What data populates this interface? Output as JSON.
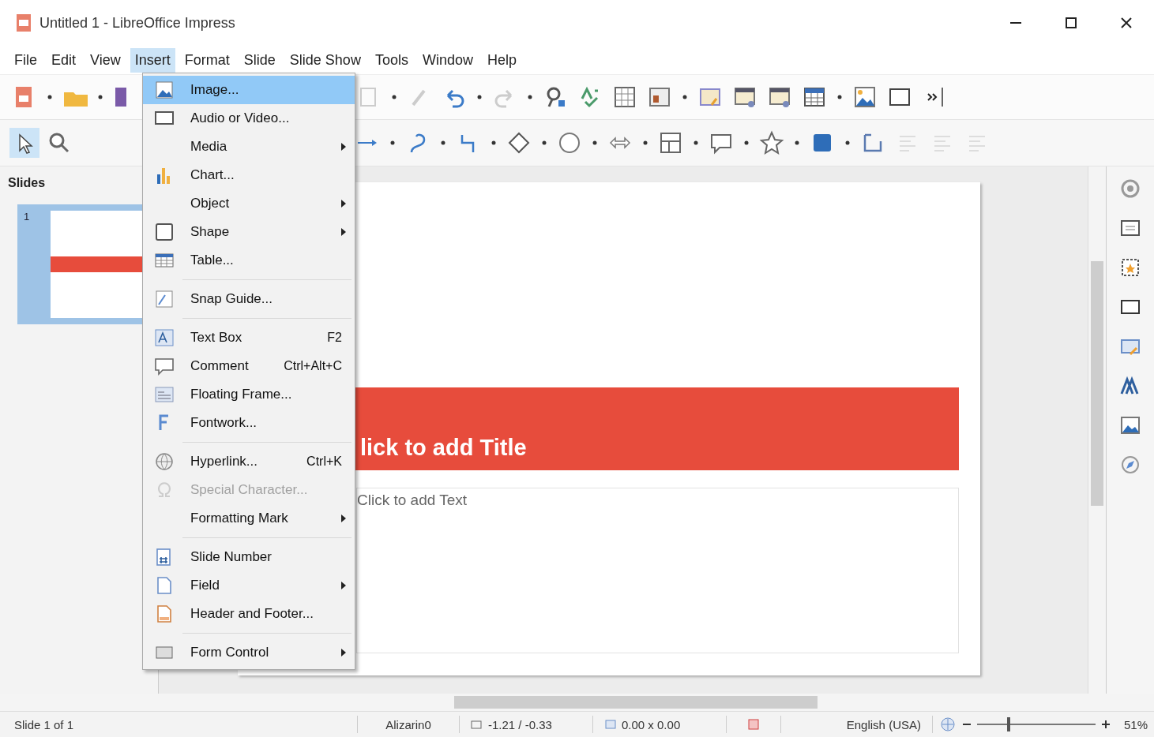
{
  "window": {
    "title": "Untitled 1 - LibreOffice Impress"
  },
  "menu_bar": [
    {
      "label": "File",
      "selected": false
    },
    {
      "label": "Edit",
      "selected": false
    },
    {
      "label": "View",
      "selected": false
    },
    {
      "label": "Insert",
      "selected": true
    },
    {
      "label": "Format",
      "selected": false
    },
    {
      "label": "Slide",
      "selected": false
    },
    {
      "label": "Slide Show",
      "selected": false
    },
    {
      "label": "Tools",
      "selected": false
    },
    {
      "label": "Window",
      "selected": false
    },
    {
      "label": "Help",
      "selected": false
    }
  ],
  "insert_menu": [
    {
      "kind": "item",
      "label": "Image...",
      "selected": true,
      "disabled": false,
      "submenu": false
    },
    {
      "kind": "item",
      "label": "Audio or Video...",
      "selected": false,
      "disabled": false,
      "submenu": false
    },
    {
      "kind": "item",
      "label": "Media",
      "selected": false,
      "disabled": false,
      "submenu": true
    },
    {
      "kind": "item",
      "label": "Chart...",
      "selected": false,
      "disabled": false,
      "submenu": false
    },
    {
      "kind": "item",
      "label": "Object",
      "selected": false,
      "disabled": false,
      "submenu": true
    },
    {
      "kind": "item",
      "label": "Shape",
      "selected": false,
      "disabled": false,
      "submenu": true
    },
    {
      "kind": "item",
      "label": "Table...",
      "selected": false,
      "disabled": false,
      "submenu": false
    },
    {
      "kind": "separator"
    },
    {
      "kind": "item",
      "label": "Snap Guide...",
      "selected": false,
      "disabled": false,
      "submenu": false
    },
    {
      "kind": "separator"
    },
    {
      "kind": "item",
      "label": "Text Box",
      "shortcut": "F2",
      "selected": false,
      "disabled": false,
      "submenu": false
    },
    {
      "kind": "item",
      "label": "Comment",
      "shortcut": "Ctrl+Alt+C",
      "selected": false,
      "disabled": false,
      "submenu": false
    },
    {
      "kind": "item",
      "label": "Floating Frame...",
      "selected": false,
      "disabled": false,
      "submenu": false
    },
    {
      "kind": "item",
      "label": "Fontwork...",
      "selected": false,
      "disabled": false,
      "submenu": false
    },
    {
      "kind": "separator"
    },
    {
      "kind": "item",
      "label": "Hyperlink...",
      "shortcut": "Ctrl+K",
      "selected": false,
      "disabled": false,
      "submenu": false
    },
    {
      "kind": "item",
      "label": "Special Character...",
      "selected": false,
      "disabled": true,
      "submenu": false
    },
    {
      "kind": "item",
      "label": "Formatting Mark",
      "selected": false,
      "disabled": false,
      "submenu": true
    },
    {
      "kind": "separator"
    },
    {
      "kind": "item",
      "label": "Slide Number",
      "selected": false,
      "disabled": false,
      "submenu": false
    },
    {
      "kind": "item",
      "label": "Field",
      "selected": false,
      "disabled": false,
      "submenu": true
    },
    {
      "kind": "item",
      "label": "Header and Footer...",
      "selected": false,
      "disabled": false,
      "submenu": false
    },
    {
      "kind": "separator"
    },
    {
      "kind": "item",
      "label": "Form Control",
      "selected": false,
      "disabled": false,
      "submenu": true
    }
  ],
  "slides_pane": {
    "title": "Slides",
    "slides": [
      {
        "number": "1",
        "selected": true
      }
    ]
  },
  "slide": {
    "title_placeholder": "lick to add Title",
    "text_placeholder": "Click to add Text"
  },
  "status_bar": {
    "slide": "Slide 1 of 1",
    "master": "Alizarin0",
    "position": "-1.21 / -0.33",
    "size": "0.00 x 0.00",
    "language": "English (USA)",
    "zoom": {
      "level": 0.27,
      "reading": "51%"
    }
  }
}
